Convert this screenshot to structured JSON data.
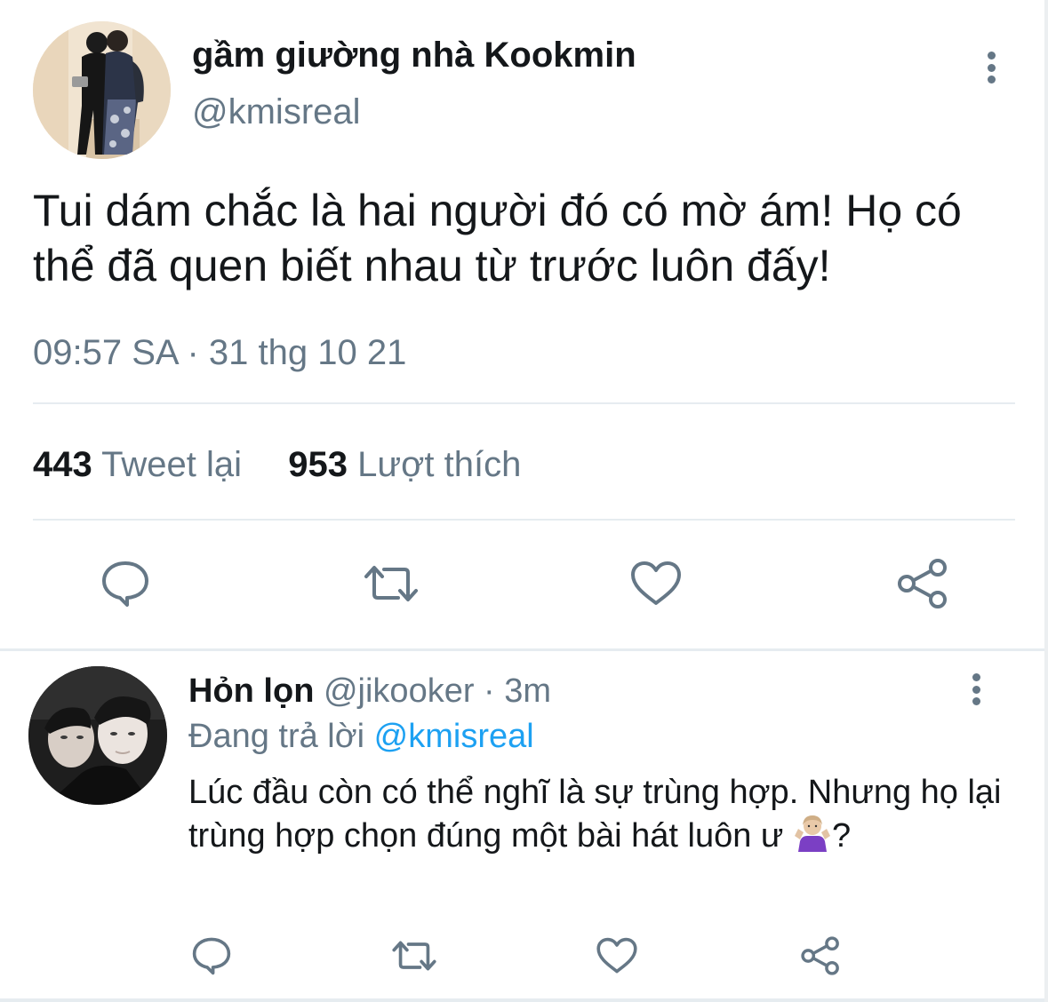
{
  "main_tweet": {
    "display_name": "gầm giường nhà Kookmin",
    "handle": "@kmisreal",
    "text": "Tui dám chắc là hai người đó có mờ ám! Họ có thể đã quen biết nhau từ trước luôn đấy!",
    "timestamp": "09:57 SA · 31 thg 10 21",
    "retweets_count": "443",
    "retweets_label": "Tweet lại",
    "likes_count": "953",
    "likes_label": "Lượt thích",
    "actions": [
      "reply-icon",
      "retweet-icon",
      "like-icon",
      "share-icon"
    ]
  },
  "reply_tweet": {
    "display_name": "Hỏn lọn",
    "handle_and_time": "@jikooker · 3m",
    "replying_prefix": "Đang trả lời",
    "replying_to": "@kmisreal",
    "text": "Lúc đầu còn có thể nghĩ là sự trùng hợp. Nhưng họ lại trùng hợp chọn đúng một bài hát luôn ư",
    "text_suffix": "?",
    "emoji": "person-shrugging-emoji",
    "actions": [
      "reply-icon",
      "retweet-icon",
      "like-icon",
      "share-icon"
    ]
  },
  "colors": {
    "text_primary": "#14171a",
    "text_secondary": "#657786",
    "accent": "#1da1f2",
    "divider": "#e6ecf0"
  }
}
